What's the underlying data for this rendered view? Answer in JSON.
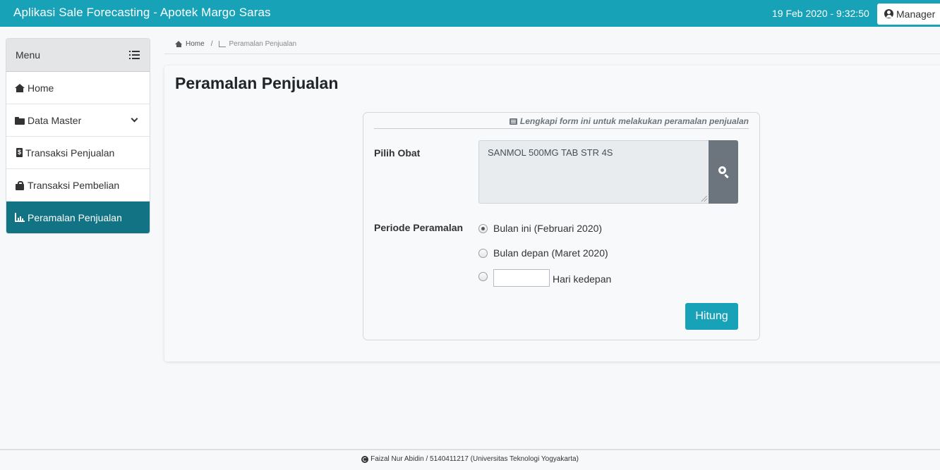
{
  "app": {
    "title": "Aplikasi Sale Forecasting - Apotek Margo Saras",
    "datetime": "19 Feb 2020 -  9:32:50",
    "user_label": "Manager",
    "accent_color": "#17a2b8"
  },
  "sidebar": {
    "header": "Menu",
    "items": [
      {
        "label": "Home",
        "icon": "home-icon"
      },
      {
        "label": "Data Master",
        "icon": "folder-icon"
      },
      {
        "label": "Transaksi Penjualan",
        "icon": "invoice-icon"
      },
      {
        "label": "Transaksi Pembelian",
        "icon": "shopping-bag-icon"
      },
      {
        "label": "Peramalan Penjualan",
        "icon": "bar-chart-icon",
        "active": true
      }
    ]
  },
  "breadcrumb": {
    "home": "Home",
    "current": "Peramalan Penjualan"
  },
  "page": {
    "title": "Peramalan Penjualan"
  },
  "form": {
    "hint": "Lengkapi form ini untuk melakukan peramalan penjualan",
    "obat_label": "Pilih Obat",
    "obat_value": "SANMOL 500MG TAB STR 4S",
    "periode_label": "Periode Peramalan",
    "options": [
      {
        "label": "Bulan ini (Februari 2020)",
        "checked": true
      },
      {
        "label": "Bulan depan (Maret 2020)",
        "checked": false
      },
      {
        "label": "Hari kedepan",
        "checked": false
      }
    ],
    "hari_value": "",
    "submit_label": "Hitung"
  },
  "footer": {
    "text": "Faizal Nur Abidin / 5140411217 (Universitas Teknologi Yogyakarta)"
  }
}
